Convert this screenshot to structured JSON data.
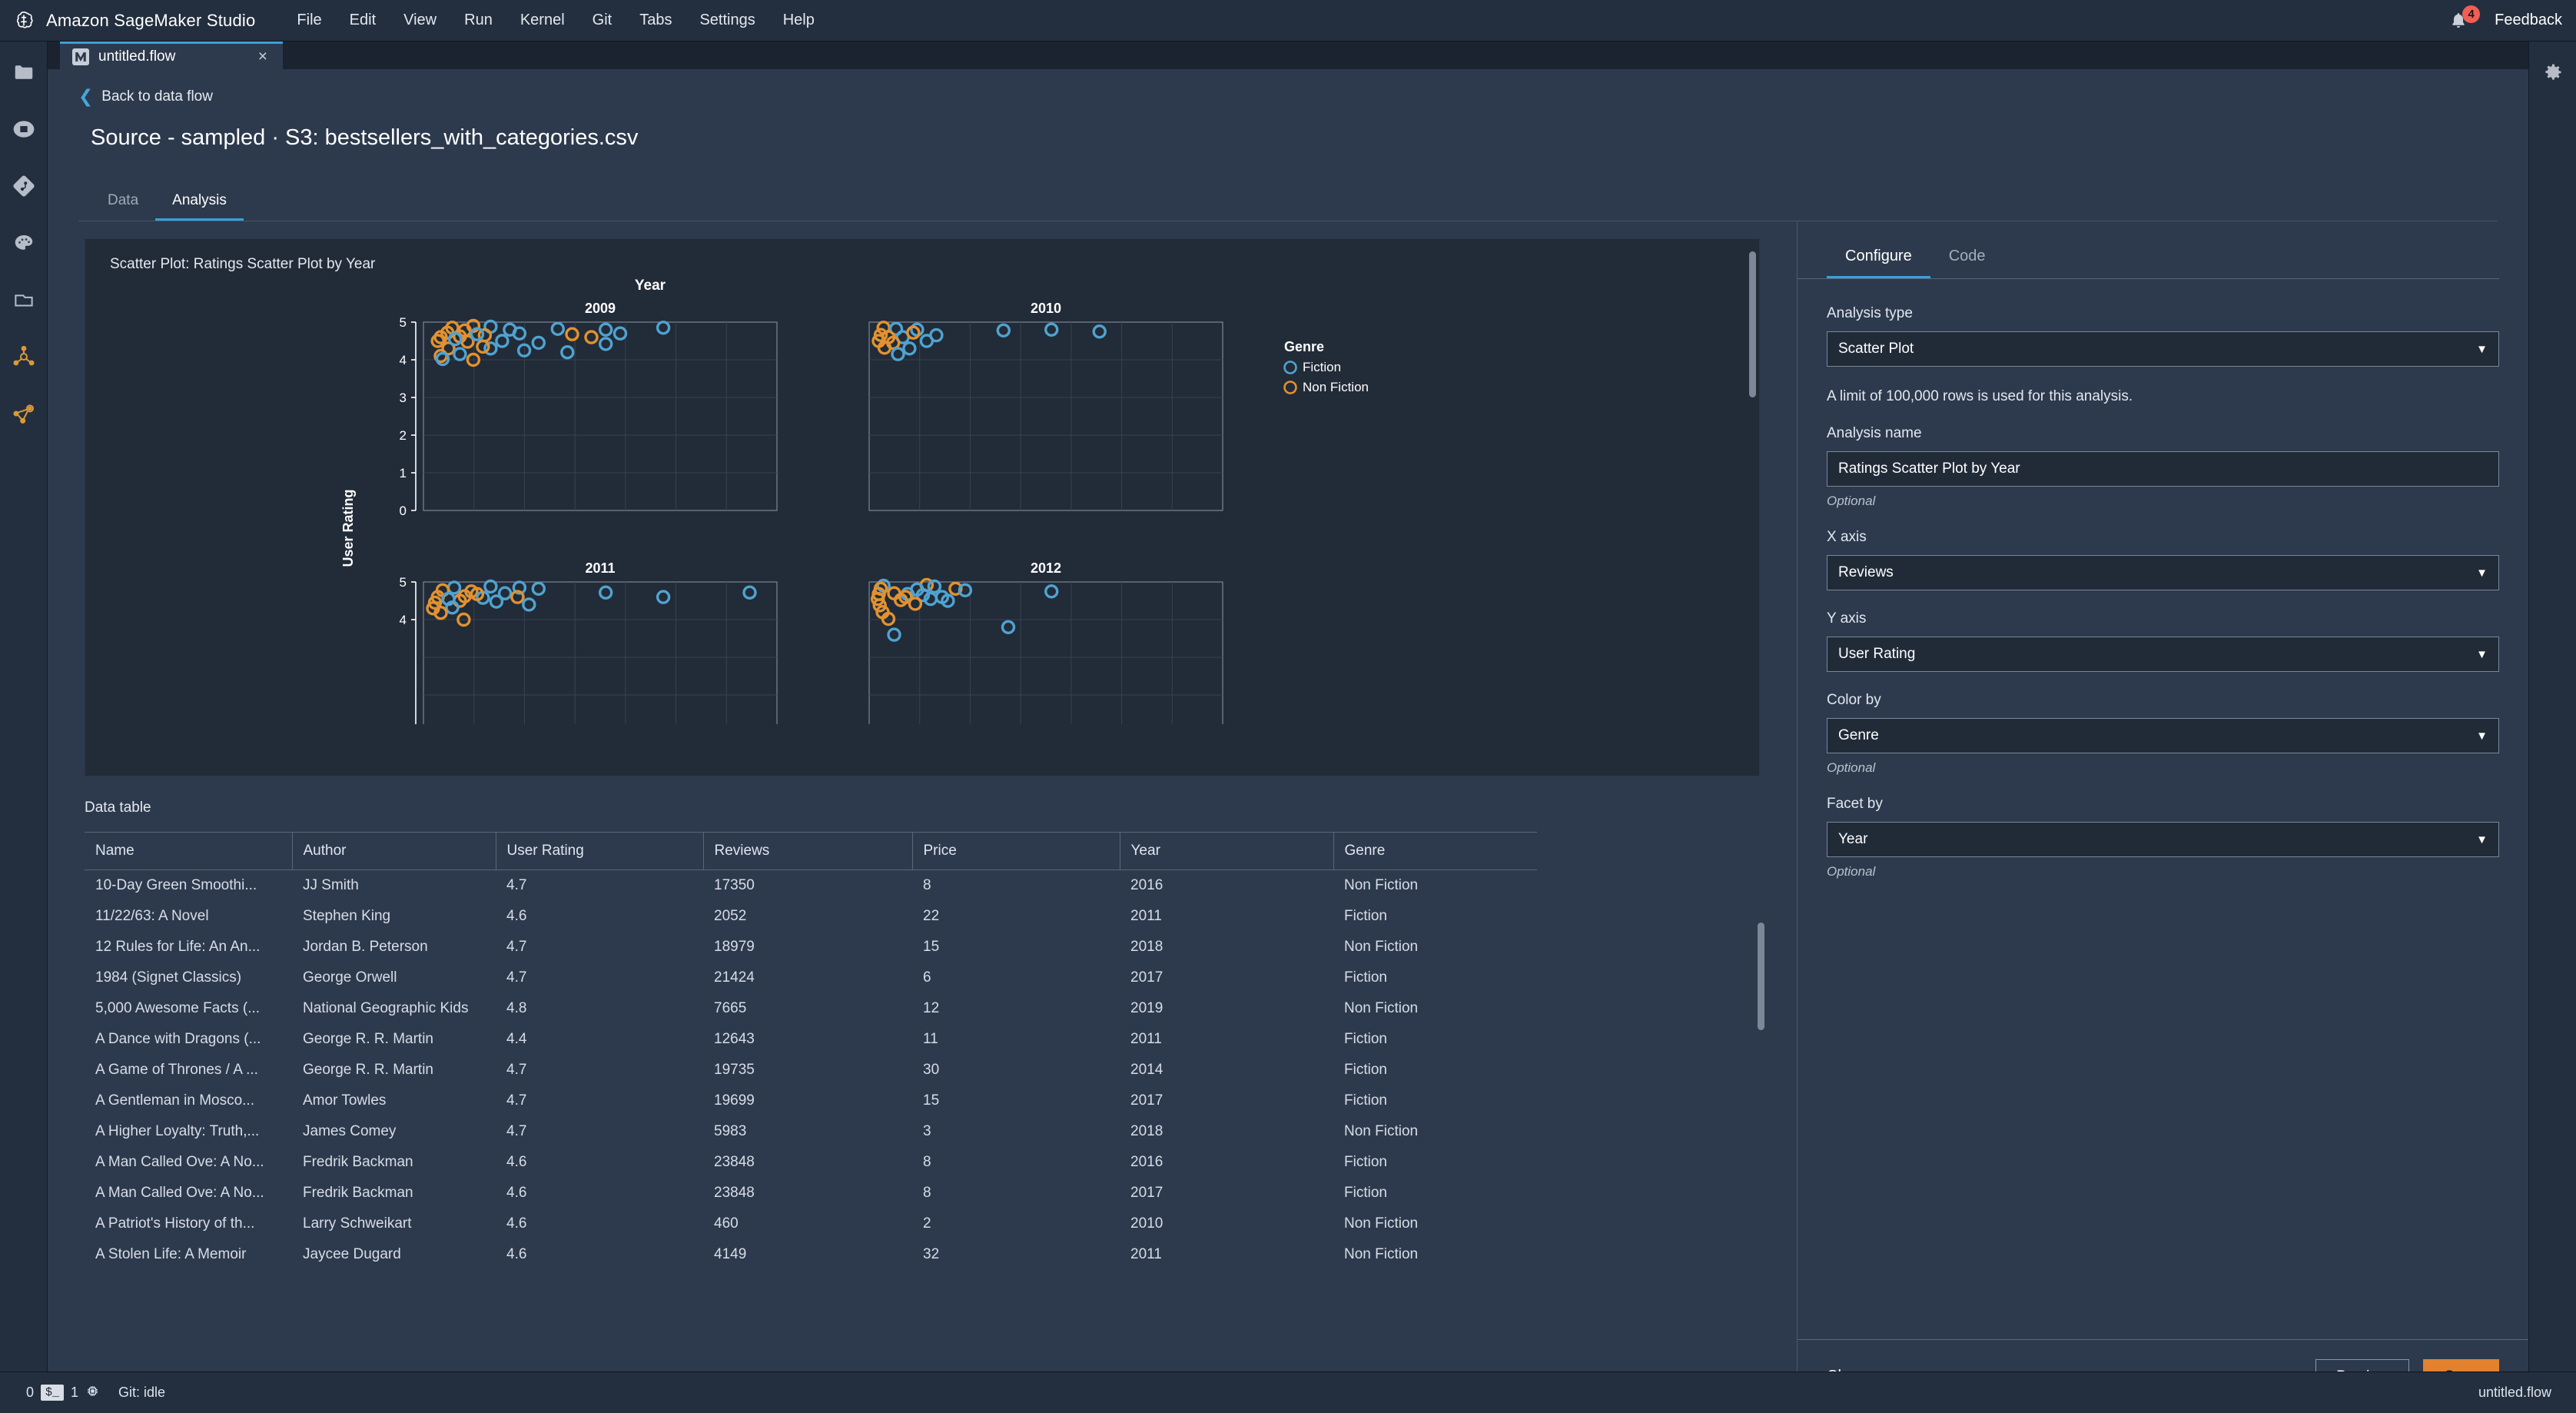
{
  "app": {
    "title": "Amazon SageMaker Studio",
    "logo_icon": "sagemaker-logo-icon",
    "menu": [
      "File",
      "Edit",
      "View",
      "Run",
      "Kernel",
      "Git",
      "Tabs",
      "Settings",
      "Help"
    ],
    "notifications": {
      "icon": "bell-icon",
      "count": "4"
    },
    "feedback": "Feedback"
  },
  "rail": {
    "items": [
      {
        "name": "file-browser-icon",
        "label": "File Browser"
      },
      {
        "name": "running-terminals-icon",
        "label": "Running Terminals and Kernels"
      },
      {
        "name": "git-icon",
        "label": "Git"
      },
      {
        "name": "palette-icon",
        "label": "Commands"
      },
      {
        "name": "open-tabs-icon",
        "label": "Open Tabs"
      },
      {
        "name": "sagemaker-components-icon",
        "label": "SageMaker Components and Registries"
      },
      {
        "name": "data-wrangler-icon",
        "label": "Data Wrangler"
      }
    ]
  },
  "right_rail": {
    "settings_icon": "gear-icon"
  },
  "tab": {
    "label": "untitled.flow",
    "icon": "flow-file-icon",
    "close": "×"
  },
  "header": {
    "back_label": "Back to data flow",
    "title": "Source - sampled · S3: bestsellers_with_categories.csv",
    "tabs": [
      {
        "label": "Data",
        "active": false
      },
      {
        "label": "Analysis",
        "active": true
      }
    ]
  },
  "chart_card": {
    "title": "Scatter Plot: Ratings Scatter Plot by Year"
  },
  "chart_data": {
    "type": "scatter",
    "title": "Year",
    "xlabel": "",
    "ylabel": "User Rating",
    "ylim": [
      0,
      5
    ],
    "yticks": [
      0,
      1,
      2,
      3,
      4,
      5
    ],
    "grid": true,
    "legend": {
      "title": "Genre",
      "position": "right",
      "entries": [
        {
          "label": "Fiction",
          "color": "#4fa3d1"
        },
        {
          "label": "Non Fiction",
          "color": "#e2922f"
        }
      ]
    },
    "facet_by": "Year",
    "facets": [
      {
        "label": "2009",
        "points": [
          {
            "x": 300,
            "y": 4.85,
            "g": "Non Fiction"
          },
          {
            "x": 520,
            "y": 4.9,
            "g": "Non Fiction"
          },
          {
            "x": 700,
            "y": 4.88,
            "g": "Fiction"
          },
          {
            "x": 250,
            "y": 4.72,
            "g": "Non Fiction"
          },
          {
            "x": 430,
            "y": 4.78,
            "g": "Non Fiction"
          },
          {
            "x": 900,
            "y": 4.8,
            "g": "Fiction"
          },
          {
            "x": 1400,
            "y": 4.82,
            "g": "Fiction"
          },
          {
            "x": 1900,
            "y": 4.8,
            "g": "Fiction"
          },
          {
            "x": 2500,
            "y": 4.85,
            "g": "Fiction"
          },
          {
            "x": 180,
            "y": 4.6,
            "g": "Non Fiction"
          },
          {
            "x": 380,
            "y": 4.62,
            "g": "Non Fiction"
          },
          {
            "x": 640,
            "y": 4.65,
            "g": "Non Fiction"
          },
          {
            "x": 1000,
            "y": 4.7,
            "g": "Fiction"
          },
          {
            "x": 1550,
            "y": 4.68,
            "g": "Non Fiction"
          },
          {
            "x": 1750,
            "y": 4.6,
            "g": "Non Fiction"
          },
          {
            "x": 2050,
            "y": 4.7,
            "g": "Fiction"
          },
          {
            "x": 150,
            "y": 4.5,
            "g": "Non Fiction"
          },
          {
            "x": 460,
            "y": 4.48,
            "g": "Non Fiction"
          },
          {
            "x": 820,
            "y": 4.5,
            "g": "Fiction"
          },
          {
            "x": 1200,
            "y": 4.45,
            "g": "Fiction"
          },
          {
            "x": 1900,
            "y": 4.42,
            "g": "Fiction"
          },
          {
            "x": 260,
            "y": 4.3,
            "g": "Non Fiction"
          },
          {
            "x": 700,
            "y": 4.3,
            "g": "Fiction"
          },
          {
            "x": 1050,
            "y": 4.25,
            "g": "Fiction"
          },
          {
            "x": 1500,
            "y": 4.2,
            "g": "Fiction"
          },
          {
            "x": 180,
            "y": 4.1,
            "g": "Non Fiction"
          },
          {
            "x": 200,
            "y": 4.02,
            "g": "Fiction"
          },
          {
            "x": 520,
            "y": 4.0,
            "g": "Non Fiction"
          },
          {
            "x": 380,
            "y": 4.15,
            "g": "Fiction"
          },
          {
            "x": 620,
            "y": 4.35,
            "g": "Non Fiction"
          },
          {
            "x": 330,
            "y": 4.55,
            "g": "Fiction"
          },
          {
            "x": 560,
            "y": 4.68,
            "g": "Fiction"
          }
        ]
      },
      {
        "label": "2010",
        "points": [
          {
            "x": 150,
            "y": 4.85,
            "g": "Non Fiction"
          },
          {
            "x": 280,
            "y": 4.82,
            "g": "Fiction"
          },
          {
            "x": 500,
            "y": 4.8,
            "g": "Fiction"
          },
          {
            "x": 1400,
            "y": 4.78,
            "g": "Fiction"
          },
          {
            "x": 1900,
            "y": 4.8,
            "g": "Fiction"
          },
          {
            "x": 2400,
            "y": 4.75,
            "g": "Fiction"
          },
          {
            "x": 120,
            "y": 4.66,
            "g": "Non Fiction"
          },
          {
            "x": 350,
            "y": 4.6,
            "g": "Fiction"
          },
          {
            "x": 700,
            "y": 4.65,
            "g": "Fiction"
          },
          {
            "x": 100,
            "y": 4.5,
            "g": "Non Fiction"
          },
          {
            "x": 250,
            "y": 4.45,
            "g": "Non Fiction"
          },
          {
            "x": 600,
            "y": 4.5,
            "g": "Fiction"
          },
          {
            "x": 160,
            "y": 4.32,
            "g": "Non Fiction"
          },
          {
            "x": 420,
            "y": 4.3,
            "g": "Fiction"
          },
          {
            "x": 300,
            "y": 4.15,
            "g": "Fiction"
          },
          {
            "x": 200,
            "y": 4.6,
            "g": "Non Fiction"
          },
          {
            "x": 460,
            "y": 4.72,
            "g": "Non Fiction"
          }
        ]
      },
      {
        "label": "2011",
        "points": [
          {
            "x": 320,
            "y": 4.85,
            "g": "Fiction"
          },
          {
            "x": 700,
            "y": 4.88,
            "g": "Fiction"
          },
          {
            "x": 1000,
            "y": 4.85,
            "g": "Fiction"
          },
          {
            "x": 1200,
            "y": 4.82,
            "g": "Fiction"
          },
          {
            "x": 200,
            "y": 4.78,
            "g": "Non Fiction"
          },
          {
            "x": 500,
            "y": 4.75,
            "g": "Non Fiction"
          },
          {
            "x": 850,
            "y": 4.7,
            "g": "Fiction"
          },
          {
            "x": 1900,
            "y": 4.72,
            "g": "Fiction"
          },
          {
            "x": 2500,
            "y": 4.6,
            "g": "Fiction"
          },
          {
            "x": 3400,
            "y": 4.72,
            "g": "Fiction"
          },
          {
            "x": 150,
            "y": 4.6,
            "g": "Non Fiction"
          },
          {
            "x": 430,
            "y": 4.62,
            "g": "Non Fiction"
          },
          {
            "x": 620,
            "y": 4.58,
            "g": "Fiction"
          },
          {
            "x": 980,
            "y": 4.6,
            "g": "Non Fiction"
          },
          {
            "x": 120,
            "y": 4.45,
            "g": "Non Fiction"
          },
          {
            "x": 380,
            "y": 4.5,
            "g": "Non Fiction"
          },
          {
            "x": 760,
            "y": 4.48,
            "g": "Fiction"
          },
          {
            "x": 1100,
            "y": 4.4,
            "g": "Fiction"
          },
          {
            "x": 100,
            "y": 4.3,
            "g": "Non Fiction"
          },
          {
            "x": 300,
            "y": 4.32,
            "g": "Fiction"
          },
          {
            "x": 180,
            "y": 4.18,
            "g": "Non Fiction"
          },
          {
            "x": 420,
            "y": 4.0,
            "g": "Non Fiction"
          },
          {
            "x": 260,
            "y": 4.55,
            "g": "Fiction"
          },
          {
            "x": 560,
            "y": 4.68,
            "g": "Non Fiction"
          }
        ]
      },
      {
        "label": "2012",
        "points": [
          {
            "x": 150,
            "y": 4.9,
            "g": "Fiction"
          },
          {
            "x": 600,
            "y": 4.92,
            "g": "Non Fiction"
          },
          {
            "x": 680,
            "y": 4.88,
            "g": "Fiction"
          },
          {
            "x": 120,
            "y": 4.82,
            "g": "Non Fiction"
          },
          {
            "x": 500,
            "y": 4.8,
            "g": "Fiction"
          },
          {
            "x": 900,
            "y": 4.82,
            "g": "Non Fiction"
          },
          {
            "x": 1000,
            "y": 4.78,
            "g": "Fiction"
          },
          {
            "x": 1900,
            "y": 4.75,
            "g": "Fiction"
          },
          {
            "x": 100,
            "y": 4.68,
            "g": "Non Fiction"
          },
          {
            "x": 260,
            "y": 4.7,
            "g": "Non Fiction"
          },
          {
            "x": 400,
            "y": 4.68,
            "g": "Fiction"
          },
          {
            "x": 560,
            "y": 4.65,
            "g": "Fiction"
          },
          {
            "x": 760,
            "y": 4.6,
            "g": "Fiction"
          },
          {
            "x": 90,
            "y": 4.55,
            "g": "Non Fiction"
          },
          {
            "x": 330,
            "y": 4.52,
            "g": "Non Fiction"
          },
          {
            "x": 640,
            "y": 4.55,
            "g": "Fiction"
          },
          {
            "x": 820,
            "y": 4.5,
            "g": "Fiction"
          },
          {
            "x": 110,
            "y": 4.38,
            "g": "Non Fiction"
          },
          {
            "x": 480,
            "y": 4.42,
            "g": "Non Fiction"
          },
          {
            "x": 140,
            "y": 4.2,
            "g": "Non Fiction"
          },
          {
            "x": 200,
            "y": 4.02,
            "g": "Non Fiction"
          },
          {
            "x": 1450,
            "y": 3.8,
            "g": "Fiction"
          },
          {
            "x": 260,
            "y": 3.6,
            "g": "Fiction"
          },
          {
            "x": 380,
            "y": 4.6,
            "g": "Non Fiction"
          }
        ]
      }
    ]
  },
  "data_table": {
    "title": "Data table",
    "columns": [
      "Name",
      "Author",
      "User Rating",
      "Reviews",
      "Price",
      "Year",
      "Genre"
    ],
    "rows": [
      [
        "10-Day Green Smoothi...",
        "JJ Smith",
        "4.7",
        "17350",
        "8",
        "2016",
        "Non Fiction"
      ],
      [
        "11/22/63: A Novel",
        "Stephen King",
        "4.6",
        "2052",
        "22",
        "2011",
        "Fiction"
      ],
      [
        "12 Rules for Life: An An...",
        "Jordan B. Peterson",
        "4.7",
        "18979",
        "15",
        "2018",
        "Non Fiction"
      ],
      [
        "1984 (Signet Classics)",
        "George Orwell",
        "4.7",
        "21424",
        "6",
        "2017",
        "Fiction"
      ],
      [
        "5,000 Awesome Facts (...",
        "National Geographic Kids",
        "4.8",
        "7665",
        "12",
        "2019",
        "Non Fiction"
      ],
      [
        "A Dance with Dragons (...",
        "George R. R. Martin",
        "4.4",
        "12643",
        "11",
        "2011",
        "Fiction"
      ],
      [
        "A Game of Thrones / A ...",
        "George R. R. Martin",
        "4.7",
        "19735",
        "30",
        "2014",
        "Fiction"
      ],
      [
        "A Gentleman in Mosco...",
        "Amor Towles",
        "4.7",
        "19699",
        "15",
        "2017",
        "Fiction"
      ],
      [
        "A Higher Loyalty: Truth,...",
        "James Comey",
        "4.7",
        "5983",
        "3",
        "2018",
        "Non Fiction"
      ],
      [
        "A Man Called Ove: A No...",
        "Fredrik Backman",
        "4.6",
        "23848",
        "8",
        "2016",
        "Fiction"
      ],
      [
        "A Man Called Ove: A No...",
        "Fredrik Backman",
        "4.6",
        "23848",
        "8",
        "2017",
        "Fiction"
      ],
      [
        "A Patriot's History of th...",
        "Larry Schweikart",
        "4.6",
        "460",
        "2",
        "2010",
        "Non Fiction"
      ],
      [
        "A Stolen Life: A Memoir",
        "Jaycee Dugard",
        "4.6",
        "4149",
        "32",
        "2011",
        "Non Fiction"
      ]
    ]
  },
  "config": {
    "tabs": [
      {
        "label": "Configure",
        "active": true
      },
      {
        "label": "Code",
        "active": false
      }
    ],
    "analysis_type": {
      "label": "Analysis type",
      "value": "Scatter Plot"
    },
    "row_limit_note": "A limit of 100,000 rows is used for this analysis.",
    "analysis_name": {
      "label": "Analysis name",
      "value": "Ratings Scatter Plot by Year",
      "hint": "Optional"
    },
    "x_axis": {
      "label": "X axis",
      "value": "Reviews"
    },
    "y_axis": {
      "label": "Y axis",
      "value": "User Rating"
    },
    "color_by": {
      "label": "Color by",
      "value": "Genre",
      "hint": "Optional"
    },
    "facet_by": {
      "label": "Facet by",
      "value": "Year",
      "hint": "Optional"
    },
    "footer": {
      "clear": "Clear",
      "preview": "Preview",
      "save": "Save"
    }
  },
  "statusbar": {
    "terminals_count": "0",
    "terminal_icon": "terminal-icon",
    "kernels_count": "1",
    "kernel_icon": "cpu-icon",
    "git_status": "Git: idle",
    "file_name": "untitled.flow"
  },
  "colors": {
    "accent_blue": "#39a0d8",
    "accent_orange": "#e2822f",
    "fiction": "#4fa3d1",
    "non_fiction": "#e2922f",
    "badge_red": "#ef5f53"
  }
}
